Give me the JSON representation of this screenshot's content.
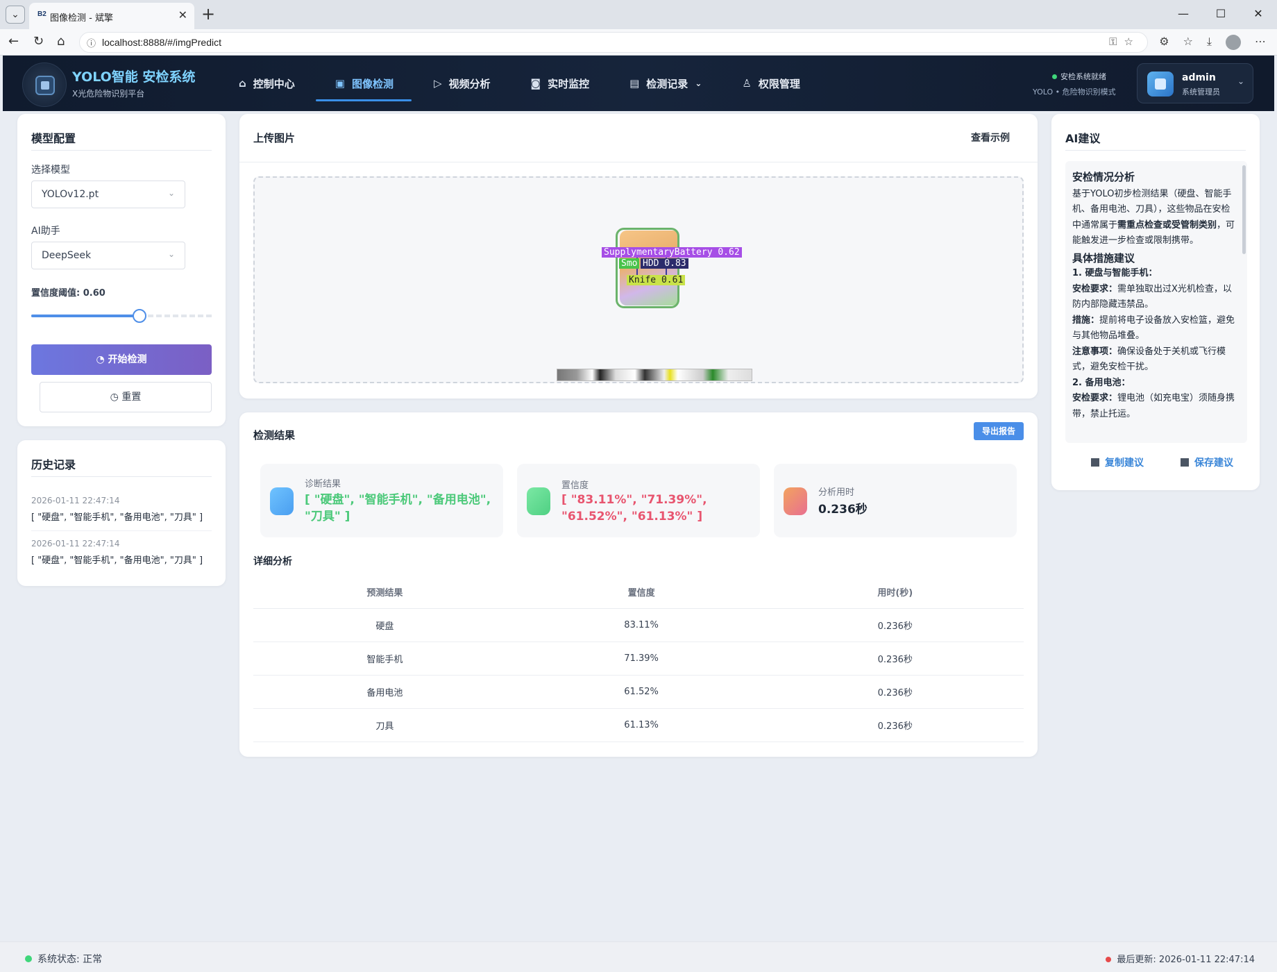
{
  "browser": {
    "tab_title": "图像检测 - 斌擎",
    "tab_favicon": "B2",
    "url": "localhost:8888/#/imgPredict"
  },
  "header": {
    "app_title": "YOLO智能 安检系统",
    "app_subtitle": "X光危险物识别平台",
    "nav": [
      {
        "label": "控制中心",
        "icon": "home-icon"
      },
      {
        "label": "图像检测",
        "icon": "image-icon",
        "active": true
      },
      {
        "label": "视频分析",
        "icon": "play-icon"
      },
      {
        "label": "实时监控",
        "icon": "camera-icon"
      },
      {
        "label": "检测记录",
        "icon": "document-icon"
      },
      {
        "label": "权限管理",
        "icon": "user-icon"
      }
    ],
    "status_text": "安检系统就绪",
    "mode_text": "YOLO • 危险物识别模式",
    "user": {
      "name": "admin",
      "role": "系统管理员"
    }
  },
  "config": {
    "title": "模型配置",
    "model_label": "选择模型",
    "model_value": "YOLOv12.pt",
    "ai_label": "AI助手",
    "ai_value": "DeepSeek",
    "threshold_label": "置信度阈值: 0.60",
    "threshold_value": 0.6,
    "start_button": "开始检测",
    "reset_button": "重置"
  },
  "history": {
    "title": "历史记录",
    "items": [
      {
        "time": "2026-01-11 22:47:14",
        "value": "[ \"硬盘\", \"智能手机\", \"备用电池\", \"刀具\" ]"
      },
      {
        "time": "2026-01-11 22:47:14",
        "value": "[ \"硬盘\", \"智能手机\", \"备用电池\", \"刀具\" ]"
      }
    ]
  },
  "upload": {
    "title": "上传图片",
    "example_link": "查看示例",
    "detections": [
      {
        "label": "SupplymentaryBattery  0.62"
      },
      {
        "label": "Smo"
      },
      {
        "label": "HDD  0.83"
      },
      {
        "label": "Knife  0.61"
      }
    ]
  },
  "results": {
    "title": "检测结果",
    "export_button": "导出报告",
    "stats": [
      {
        "label": "诊断结果",
        "value": "[ \"硬盘\", \"智能手机\", \"备用电池\", \"刀具\" ]",
        "color": "#4cc97a"
      },
      {
        "label": "置信度",
        "value": "[ \"83.11%\", \"71.39%\", \"61.52%\", \"61.13%\" ]",
        "color": "#e8556f"
      },
      {
        "label": "分析用时",
        "value": "0.236秒",
        "color": "#1f2937"
      }
    ],
    "detail_title": "详细分析",
    "columns": [
      "预测结果",
      "置信度",
      "用时(秒)"
    ],
    "rows": [
      [
        "硬盘",
        "83.11%",
        "0.236秒"
      ],
      [
        "智能手机",
        "71.39%",
        "0.236秒"
      ],
      [
        "备用电池",
        "61.52%",
        "0.236秒"
      ],
      [
        "刀具",
        "61.13%",
        "0.236秒"
      ]
    ]
  },
  "ai": {
    "title": "AI建议",
    "heading1": "安检情况分析",
    "para1_a": "基于YOLO初步检测结果（硬盘、智能手机、备用电池、刀具），这些物品在安检中通常属于",
    "para1_b": "需重点检查或受管制类别",
    "para1_c": "，可能触发进一步检查或限制携带。",
    "heading2": "具体措施建议",
    "sub1": "1. 硬盘与智能手机：",
    "req_label": "安检要求：",
    "req1": "需单独取出过X光机检查，以防内部隐藏违禁品。",
    "measure_label": "措施：",
    "measure1": "提前将电子设备放入安检篮，避免与其他物品堆叠。",
    "note_label": "注意事项：",
    "note1": "确保设备处于关机或飞行模式，避免安检干扰。",
    "sub2": "2. 备用电池：",
    "req2": "锂电池（如充电宝）须随身携带，禁止托运。",
    "copy_button": "复制建议",
    "save_button": "保存建议"
  },
  "footer": {
    "status": "系统状态: 正常",
    "updated": "最后更新: 2026-01-11 22:47:14"
  },
  "colors": {
    "accent": "#4a8ee8",
    "header_bg": "#131f33",
    "success": "#3fd67a"
  }
}
